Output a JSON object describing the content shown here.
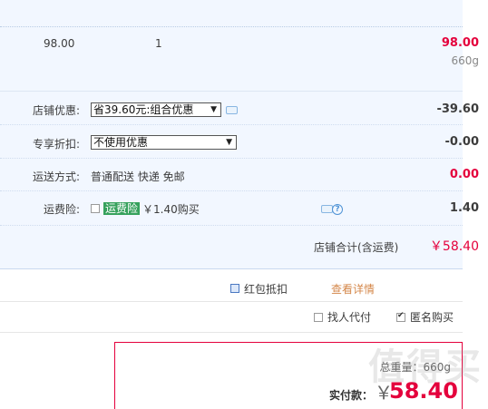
{
  "item": {
    "price": "98.00",
    "quantity": "1",
    "subtotal": "98.00",
    "weight": "660g"
  },
  "shop_discount": {
    "label": "店铺优惠:",
    "selected": "省39.60元:组合优惠",
    "amount": "-39.60"
  },
  "exclusive_discount": {
    "label": "专享折扣:",
    "selected": "不使用优惠",
    "amount": "-0.00"
  },
  "shipping": {
    "label": "运送方式:",
    "method": "普通配送 快递 免邮",
    "amount": "0.00"
  },
  "shipping_insurance": {
    "label": "运费险:",
    "name": "运费险",
    "price_text": "￥1.40购买",
    "amount": "1.40"
  },
  "shop_total": {
    "label": "店铺合计(含运费)",
    "amount": "￥58.40"
  },
  "red_packet": {
    "label": "红包抵扣",
    "details_link": "查看详情"
  },
  "options": {
    "pay_for_me": "找人代付",
    "anonymous": "匿名购买"
  },
  "summary": {
    "weight": "总重量：660g",
    "paid_label": "实付款：",
    "currency": "￥",
    "paid_amount": "58.40"
  },
  "watermark": "值得买",
  "colors": {
    "accent_red": "#e4003c",
    "panel_bg": "#f2f7ff",
    "highlight_green": "#36a15c"
  }
}
